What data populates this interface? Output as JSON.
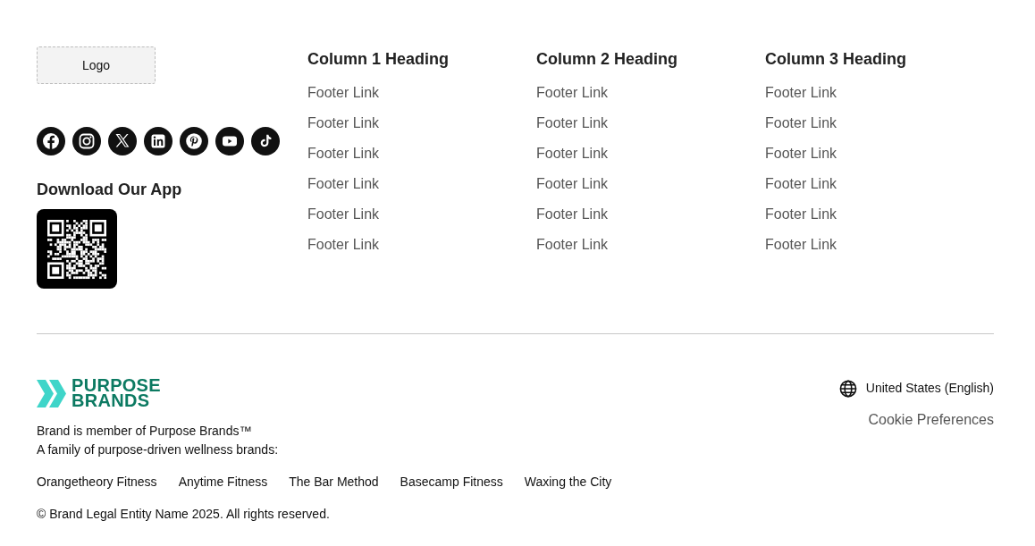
{
  "top": {
    "logo": {
      "label": "Logo"
    },
    "social_icons": [
      {
        "kind": "facebook"
      },
      {
        "kind": "instagram"
      },
      {
        "kind": "x"
      },
      {
        "kind": "linkedin"
      },
      {
        "kind": "pinterest"
      },
      {
        "kind": "youtube"
      },
      {
        "kind": "tiktok"
      }
    ],
    "app": {
      "heading": "Download Our App"
    },
    "columns": [
      {
        "heading": "Column 1 Heading",
        "links": [
          "Footer Link",
          "Footer Link",
          "Footer Link",
          "Footer Link",
          "Footer Link",
          "Footer Link"
        ]
      },
      {
        "heading": "Column 2 Heading",
        "links": [
          "Footer Link",
          "Footer Link",
          "Footer Link",
          "Footer Link",
          "Footer Link",
          "Footer Link"
        ]
      },
      {
        "heading": "Column 3 Heading",
        "links": [
          "Footer Link",
          "Footer Link",
          "Footer Link",
          "Footer Link",
          "Footer Link",
          "Footer Link"
        ]
      }
    ]
  },
  "bottom": {
    "brand_logo": {
      "lines": [
        "PURPOSE",
        "BRANDS"
      ]
    },
    "membership_lines": [
      "Brand is member of Purpose Brands™",
      "A family of purpose-driven wellness brands:"
    ],
    "family_brands": [
      "Orangetheory Fitness",
      "Anytime Fitness",
      "The Bar Method",
      "Basecamp Fitness",
      "Waxing the City"
    ],
    "copyright": "© Brand Legal Entity Name 2025. All rights reserved.",
    "locale": "United States (English)",
    "cookie_link": "Cookie Preferences"
  }
}
